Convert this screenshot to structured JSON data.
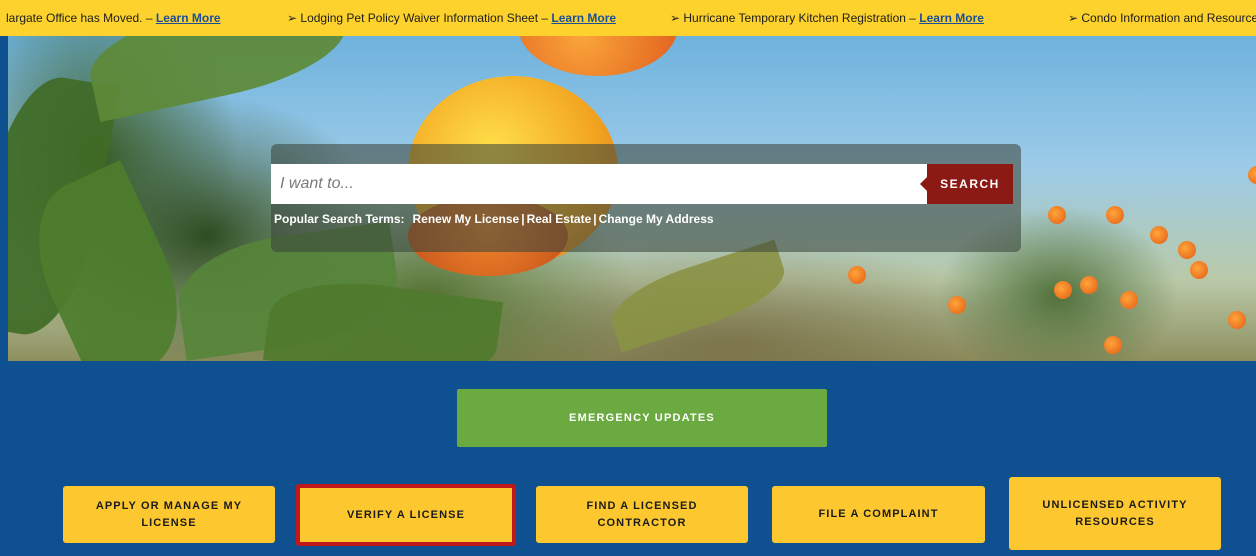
{
  "ticker": {
    "items": [
      {
        "text": "largate Office has Moved.  – ",
        "link": "Learn More"
      },
      {
        "text": "➢ Lodging Pet Policy Waiver Information Sheet – ",
        "link": "Learn More"
      },
      {
        "text": "➢ Hurricane Temporary Kitchen Registration  – ",
        "link": "Learn More"
      },
      {
        "text": "➢ Condo Information and Resources",
        "link": ""
      }
    ]
  },
  "search": {
    "placeholder": "I want to...",
    "button_label": "SEARCH",
    "popular_label": "Popular Search Terms:",
    "terms": [
      "Renew My License",
      "Real Estate",
      "Change My Address"
    ],
    "separator": "|"
  },
  "emergency": {
    "label": "EMERGENCY UPDATES",
    "color": "#6aaa40"
  },
  "cards": [
    {
      "label": "APPLY OR MANAGE MY LICENSE"
    },
    {
      "label": "VERIFY A LICENSE",
      "selected": true
    },
    {
      "label": "FIND A LICENSED CONTRACTOR"
    },
    {
      "label": "FILE A COMPLAINT"
    },
    {
      "label": "UNLICENSED ACTIVITY RESOURCES"
    }
  ],
  "colors": {
    "ticker_bg": "#fdd22d",
    "blue_bg": "#0f5190",
    "card_bg": "#fdc82f",
    "selected_border": "#c0171b",
    "search_button": "#8b1a15"
  }
}
